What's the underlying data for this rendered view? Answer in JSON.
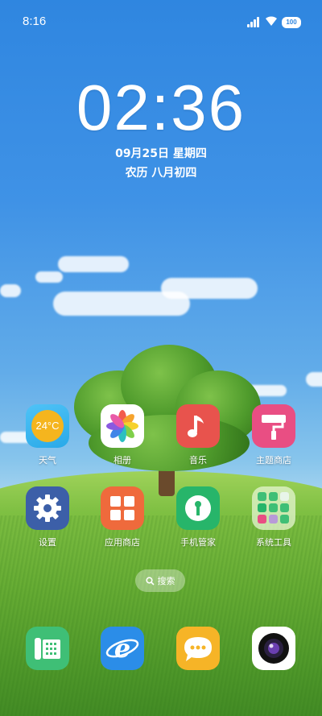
{
  "status_bar": {
    "time": "8:16",
    "battery": "100"
  },
  "clock": {
    "time": "02:36",
    "date": "09月25日 星期四",
    "lunar": "农历 八月初四"
  },
  "apps": {
    "weather": {
      "label": "天气",
      "temp": "24°C"
    },
    "gallery": {
      "label": "相册"
    },
    "music": {
      "label": "音乐"
    },
    "theme": {
      "label": "主题商店"
    },
    "settings": {
      "label": "设置"
    },
    "appstore": {
      "label": "应用商店"
    },
    "security": {
      "label": "手机管家"
    },
    "tools": {
      "label": "系统工具"
    }
  },
  "search": {
    "label": "搜索"
  },
  "dock": [
    "phone",
    "browser",
    "messages",
    "camera"
  ],
  "colors": {
    "weather": "#f5b51e",
    "music": "#e8534d",
    "theme": "#e94e83",
    "settings": "#3c5fa8",
    "appstore": "#ef6a3c",
    "security": "#27b56a",
    "phone": "#3fbf76",
    "browser": "#2b8de8",
    "messages": "#f6b427"
  }
}
